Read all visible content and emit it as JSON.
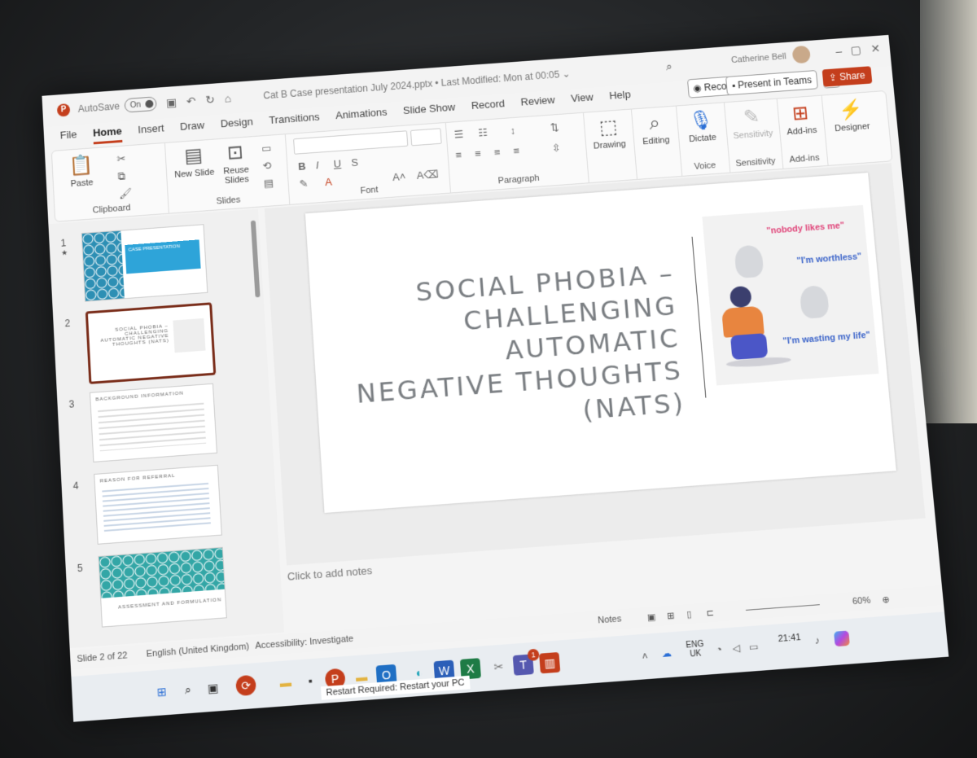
{
  "titlebar": {
    "app_logo": "P",
    "autosave_label": "AutoSave",
    "autosave_state": "On",
    "document_title": "Cat B Case presentation July 2024.pptx • Last Modified: Mon at 00:05 ⌄",
    "user_name": "Catherine Bell",
    "record_label": "Record",
    "present_teams_label": "Present in Teams",
    "share_label": "Share"
  },
  "tabs": [
    "File",
    "Home",
    "Insert",
    "Draw",
    "Design",
    "Transitions",
    "Animations",
    "Slide Show",
    "Record",
    "Review",
    "View",
    "Help"
  ],
  "active_tab": "Home",
  "ribbon": {
    "clipboard": {
      "paste": "Paste",
      "label": "Clipboard"
    },
    "slides": {
      "new_slide": "New Slide",
      "reuse_slides": "Reuse Slides",
      "label": "Slides"
    },
    "font": {
      "bold": "B",
      "italic": "I",
      "underline": "U",
      "strike": "S",
      "label": "Font"
    },
    "paragraph": {
      "label": "Paragraph"
    },
    "drawing": "Drawing",
    "editing": "Editing",
    "voice": {
      "dictate": "Dictate",
      "label": "Voice"
    },
    "sensitivity": {
      "button": "Sensitivity",
      "label": "Sensitivity"
    },
    "addins": {
      "button": "Add-ins",
      "label": "Add-ins"
    },
    "designer": "Designer"
  },
  "thumbnails": [
    {
      "num": "1",
      "star": "★",
      "title": "CASE PRESENTATION"
    },
    {
      "num": "2",
      "title": "SOCIAL PHOBIA – CHALLENGING AUTOMATIC NEGATIVE THOUGHTS (NATS)"
    },
    {
      "num": "3",
      "title": "BACKGROUND INFORMATION"
    },
    {
      "num": "4",
      "title": "REASON FOR REFERRAL"
    },
    {
      "num": "5",
      "title": "ASSESSMENT AND FORMULATION"
    }
  ],
  "slide": {
    "title_lines": [
      "SOCIAL PHOBIA –",
      "CHALLENGING AUTOMATIC",
      "NEGATIVE THOUGHTS",
      "(NATS)"
    ],
    "quote1": "\"nobody likes me\"",
    "quote2": "\"I'm worthless\"",
    "quote3": "\"I'm wasting my life\"",
    "quote_colors": {
      "q1": "#e0457a",
      "q2": "#3a63c9",
      "q3": "#3a63c9"
    }
  },
  "notes_placeholder": "Click to add notes",
  "status": {
    "slide_count": "Slide 2 of 22",
    "language": "English (United Kingdom)",
    "accessibility": "Accessibility: Investigate",
    "notes": "Notes",
    "zoom": "60%"
  },
  "taskbar": {
    "toast": "Restart Required: Restart your PC",
    "lang": "ENG",
    "region": "UK",
    "time": "21:41",
    "teams_badge": "1"
  }
}
